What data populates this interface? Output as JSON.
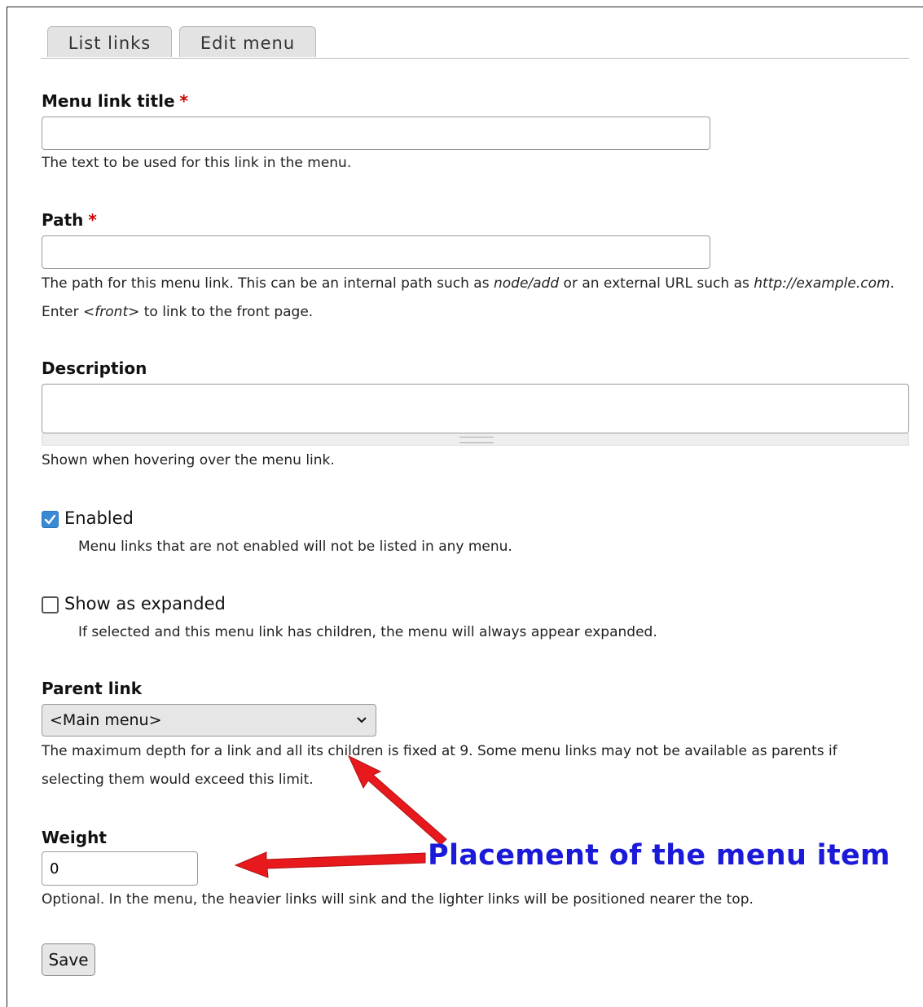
{
  "tabs": [
    {
      "label": "List links"
    },
    {
      "label": "Edit menu"
    }
  ],
  "form": {
    "title_label": "Menu link title",
    "required_mark": "*",
    "title_value": "",
    "title_desc": "The text to be used for this link in the menu.",
    "path_label": "Path",
    "path_value": "",
    "path_desc_1": "The path for this menu link. This can be an internal path such as ",
    "path_desc_em1": "node/add",
    "path_desc_2": " or an external URL such as ",
    "path_desc_em2": "http://example.com",
    "path_desc_3": ".",
    "path_desc_4": "Enter ",
    "path_desc_em3": "<front>",
    "path_desc_5": " to link to the front page.",
    "description_label": "Description",
    "description_value": "",
    "description_desc": "Shown when hovering over the menu link.",
    "enabled_label": "Enabled",
    "enabled_checked": true,
    "enabled_desc": "Menu links that are not enabled will not be listed in any menu.",
    "expanded_label": "Show as expanded",
    "expanded_checked": false,
    "expanded_desc": "If selected and this menu link has children, the menu will always appear expanded.",
    "parent_label": "Parent link",
    "parent_value": "<Main menu>",
    "parent_desc_1": "The maximum depth for a link and all its children is fixed at 9. Some menu links may not be available as parents if",
    "parent_desc_2": "selecting them would exceed this limit.",
    "weight_label": "Weight",
    "weight_value": "0",
    "weight_desc": "Optional. In the menu, the heavier links will sink and the lighter links will be positioned nearer the top.",
    "save_label": "Save"
  },
  "annotation": {
    "text": "Placement of the menu item",
    "text_color": "#1a1ad8",
    "arrow_color": "#e8191c"
  },
  "colors": {
    "required": "#cc0000",
    "checkbox_checked": "#3b88d4"
  }
}
